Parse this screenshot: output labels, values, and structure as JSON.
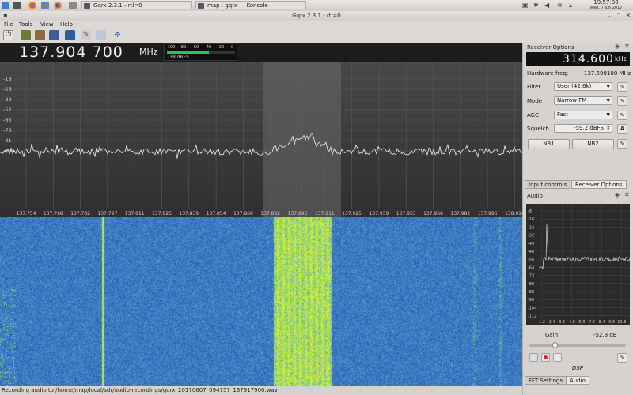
{
  "taskbar": {
    "tasks": [
      {
        "label": "Gqrx 2.3.1 - rtl=0"
      },
      {
        "label": "map : gqrx — Konsole"
      }
    ],
    "clock_time": "19:57:38",
    "clock_date": "Wed, 7 Jun 2017"
  },
  "window": {
    "title": "Gqrx 2.3.1 - rtl=0"
  },
  "menubar": {
    "items": [
      "File",
      "Tools",
      "View",
      "Help"
    ]
  },
  "toolbar": {
    "icons": [
      "power-icon",
      "device-icon",
      "open-icon",
      "save-icon",
      "display-icon",
      "settings-icon",
      "fullscreen-icon"
    ]
  },
  "frequency": {
    "value": "137.904 700",
    "unit": "MHz"
  },
  "meter": {
    "ticks": [
      "-100",
      "-80",
      "-60",
      "-40",
      "-20",
      "0"
    ],
    "value": "-38 dBFS",
    "level_fraction": 0.62
  },
  "plot": {
    "y_ticks": [
      "-13",
      "-26",
      "-39",
      "-52",
      "-65",
      "-78",
      "-91",
      "-104"
    ],
    "x_ticks": [
      "137.754",
      "137.768",
      "137.782",
      "137.797",
      "137.811",
      "137.825",
      "137.839",
      "137.854",
      "137.868",
      "137.882",
      "137.896",
      "137.911",
      "137.925",
      "137.939",
      "137.953",
      "137.968",
      "137.982",
      "137.996",
      "138.010"
    ]
  },
  "status": {
    "text": "Recording audio to /home/map/local/sdr/audio-recordings/gqrx_20170607_094757_137917900.wav"
  },
  "receiver": {
    "title": "Receiver Options",
    "offset": "314.600",
    "offset_unit": "kHz",
    "hardware_freq_label": "Hardware freq:",
    "hardware_freq": "137.590100 MHz",
    "filter_label": "Filter",
    "filter_value": "User (42.6k)",
    "mode_label": "Mode",
    "mode_value": "Narrow FM",
    "agc_label": "AGC",
    "agc_value": "Fast",
    "squelch_label": "Squelch",
    "squelch_value": "-59.2 dBFS",
    "squelch_auto": "A",
    "nb1": "NB1",
    "nb2": "NB2"
  },
  "tabs_top": [
    "Input controls",
    "Receiver Options"
  ],
  "audio": {
    "title": "Audio",
    "y_ticks": [
      "-8",
      "-16",
      "-24",
      "-32",
      "-40",
      "-48",
      "-56",
      "-64",
      "-72",
      "-80",
      "-88",
      "-96",
      "-104",
      "-112"
    ],
    "x_ticks": [
      "1.2",
      "2.4",
      "3.6",
      "4.8",
      "6.0",
      "7.2",
      "8.4",
      "9.6",
      "10.8"
    ],
    "gain_label": "Gain:",
    "gain_value": "-52.8 dB",
    "gain_fraction": 0.25,
    "dsp_label": "DSP"
  },
  "tabs_bottom": [
    "FFT Settings",
    "Audio"
  ]
}
